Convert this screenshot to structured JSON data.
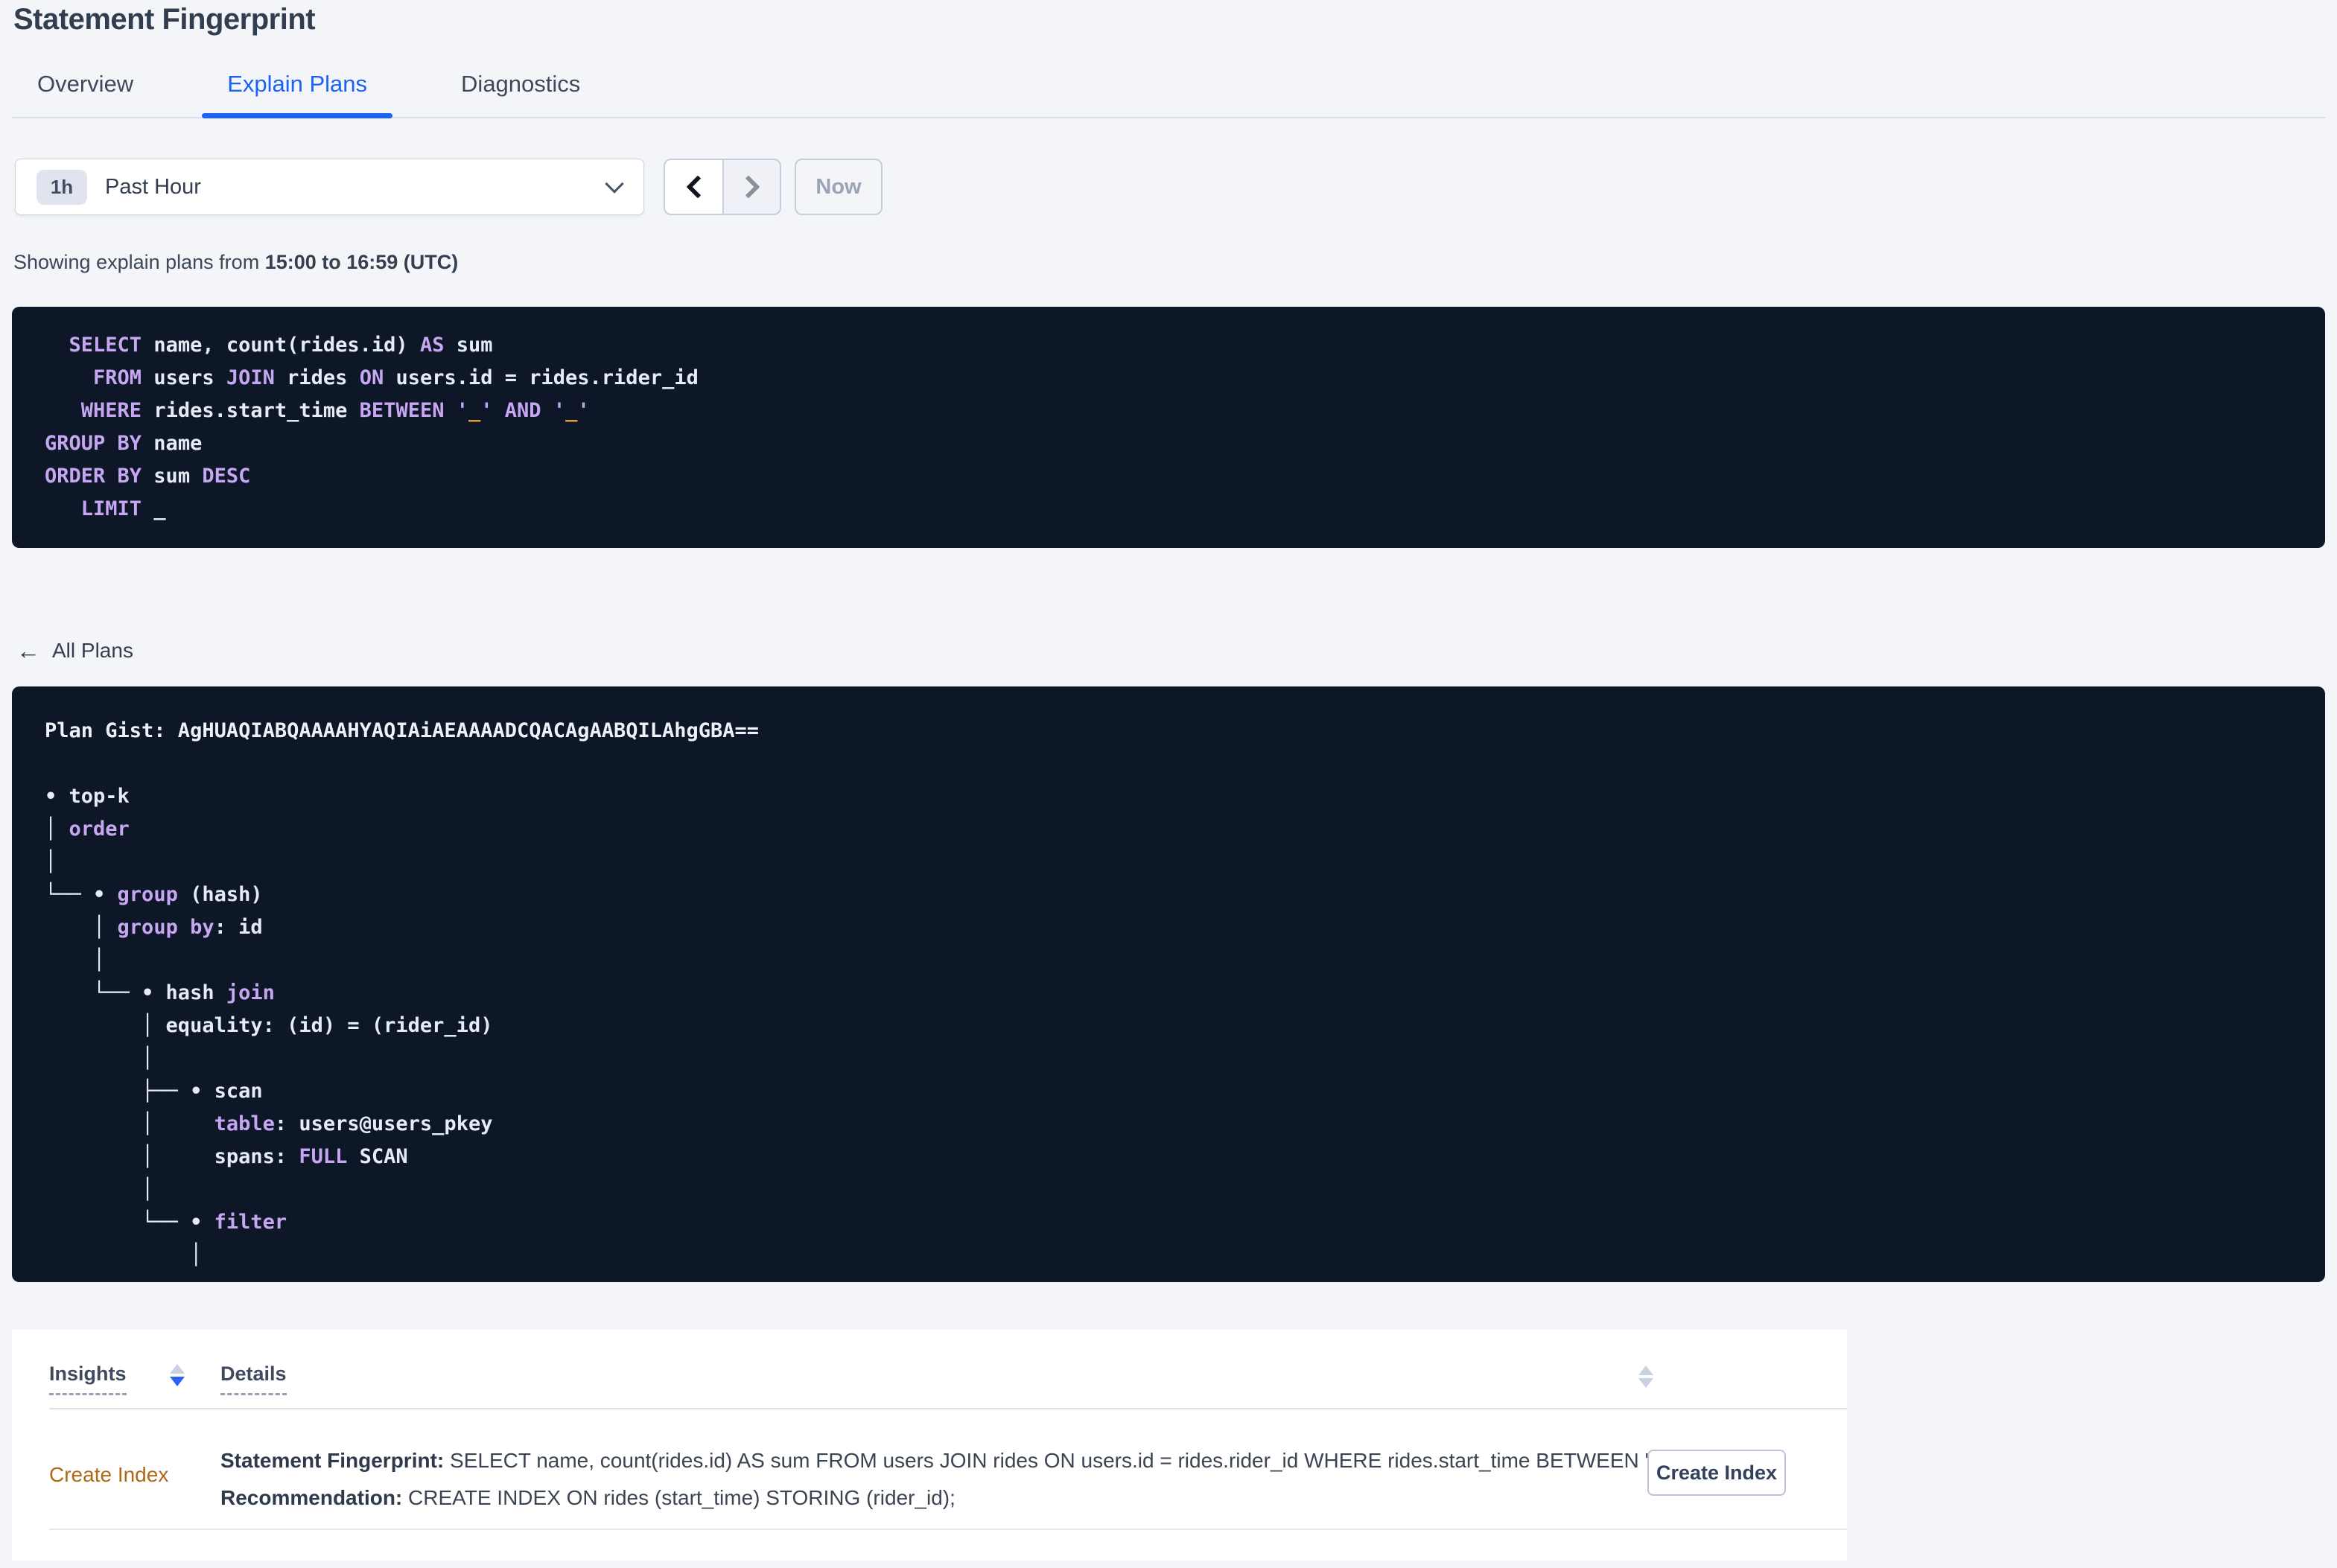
{
  "page_title": "Statement Fingerprint",
  "tabs": [
    {
      "label": "Overview",
      "active": false
    },
    {
      "label": "Explain Plans",
      "active": true
    },
    {
      "label": "Diagnostics",
      "active": false
    }
  ],
  "time_selector": {
    "badge": "1h",
    "selected_label": "Past Hour",
    "now_label": "Now"
  },
  "showing": {
    "prefix": "Showing explain plans from ",
    "range": "15:00 to 16:59 (UTC)"
  },
  "sql_block": {
    "lines": [
      [
        {
          "c": "p",
          "t": "  "
        },
        {
          "c": "k",
          "t": "SELECT"
        },
        {
          "c": "p",
          "t": " name, count(rides.id) "
        },
        {
          "c": "k",
          "t": "AS"
        },
        {
          "c": "p",
          "t": " sum"
        }
      ],
      [
        {
          "c": "p",
          "t": "    "
        },
        {
          "c": "k",
          "t": "FROM"
        },
        {
          "c": "p",
          "t": " users "
        },
        {
          "c": "k",
          "t": "JOIN"
        },
        {
          "c": "p",
          "t": " rides "
        },
        {
          "c": "k",
          "t": "ON"
        },
        {
          "c": "p",
          "t": " users.id = rides.rider_id"
        }
      ],
      [
        {
          "c": "p",
          "t": "   "
        },
        {
          "c": "k",
          "t": "WHERE"
        },
        {
          "c": "p",
          "t": " rides.start_time "
        },
        {
          "c": "k",
          "t": "BETWEEN"
        },
        {
          "c": "p",
          "t": " "
        },
        {
          "c": "q",
          "t": "'"
        },
        {
          "c": "s",
          "t": "_"
        },
        {
          "c": "q",
          "t": "'"
        },
        {
          "c": "p",
          "t": " "
        },
        {
          "c": "k",
          "t": "AND"
        },
        {
          "c": "p",
          "t": " "
        },
        {
          "c": "q",
          "t": "'"
        },
        {
          "c": "s",
          "t": "_"
        },
        {
          "c": "q",
          "t": "'"
        }
      ],
      [
        {
          "c": "k",
          "t": "GROUP BY"
        },
        {
          "c": "p",
          "t": " name"
        }
      ],
      [
        {
          "c": "k",
          "t": "ORDER BY"
        },
        {
          "c": "p",
          "t": " sum "
        },
        {
          "c": "k",
          "t": "DESC"
        }
      ],
      [
        {
          "c": "p",
          "t": "   "
        },
        {
          "c": "k",
          "t": "LIMIT"
        },
        {
          "c": "p",
          "t": " _"
        }
      ]
    ]
  },
  "all_plans_label": "All Plans",
  "plan_gist": "AgHUAQIABQAAAAHYAQIAiAEAAAADCQACAgAABQILAhgGBA==",
  "plan_gist_block": {
    "lines": [
      [
        {
          "c": "g",
          "t": "Plan Gist: AgHUAQIABQAAAAHYAQIAiAEAAAADCQACAgAABQILAhgGBA=="
        }
      ],
      [],
      [
        {
          "c": "p",
          "t": "• top-k"
        }
      ],
      [
        {
          "c": "p",
          "t": "│ "
        },
        {
          "c": "k",
          "t": "order"
        }
      ],
      [
        {
          "c": "p",
          "t": "│"
        }
      ],
      [
        {
          "c": "p",
          "t": "└── • "
        },
        {
          "c": "k",
          "t": "group"
        },
        {
          "c": "p",
          "t": " (hash)"
        }
      ],
      [
        {
          "c": "p",
          "t": "    │ "
        },
        {
          "c": "k",
          "t": "group by"
        },
        {
          "c": "p",
          "t": ": id"
        }
      ],
      [
        {
          "c": "p",
          "t": "    │"
        }
      ],
      [
        {
          "c": "p",
          "t": "    └── • hash "
        },
        {
          "c": "k",
          "t": "join"
        }
      ],
      [
        {
          "c": "p",
          "t": "        │ equality: (id) = (rider_id)"
        }
      ],
      [
        {
          "c": "p",
          "t": "        │"
        }
      ],
      [
        {
          "c": "p",
          "t": "        ├── • scan"
        }
      ],
      [
        {
          "c": "p",
          "t": "        │     "
        },
        {
          "c": "k",
          "t": "table"
        },
        {
          "c": "p",
          "t": ": users@users_pkey"
        }
      ],
      [
        {
          "c": "p",
          "t": "        │     spans: "
        },
        {
          "c": "k",
          "t": "FULL"
        },
        {
          "c": "p",
          "t": " SCAN"
        }
      ],
      [
        {
          "c": "p",
          "t": "        │"
        }
      ],
      [
        {
          "c": "p",
          "t": "        └── • "
        },
        {
          "c": "k",
          "t": "filter"
        }
      ],
      [
        {
          "c": "p",
          "t": "            │"
        }
      ]
    ]
  },
  "insights_table": {
    "columns": [
      {
        "label": "Insights"
      },
      {
        "label": "Details"
      }
    ],
    "rows": [
      {
        "insight": "Create Index",
        "detail_line1_label": "Statement Fingerprint:",
        "detail_line1": " SELECT name, count(rides.id) AS sum FROM users JOIN rides ON users.id = rides.rider_id WHERE rides.start_time BETWEEN '_…",
        "detail_line2_label": "Recommendation:",
        "detail_line2": " CREATE INDEX ON rides (start_time) STORING (rider_id);",
        "action_label": "Create Index"
      }
    ]
  },
  "icons": {
    "back_arrow": "←",
    "caret_down": "chevron-down",
    "prev": "chevron-left",
    "next": "chevron-right",
    "sort": "up-down-triangles"
  },
  "colors": {
    "accent_blue": "#1b63f4",
    "panel_background": "#0e1728",
    "keyword_purple": "#c7a6f2",
    "code_text": "#e6ecf5",
    "literal_orange": "#e09a41",
    "insight_link_orange": "#b06818",
    "page_background": "#f3f5f9",
    "heading_slate": "#323d4f"
  }
}
